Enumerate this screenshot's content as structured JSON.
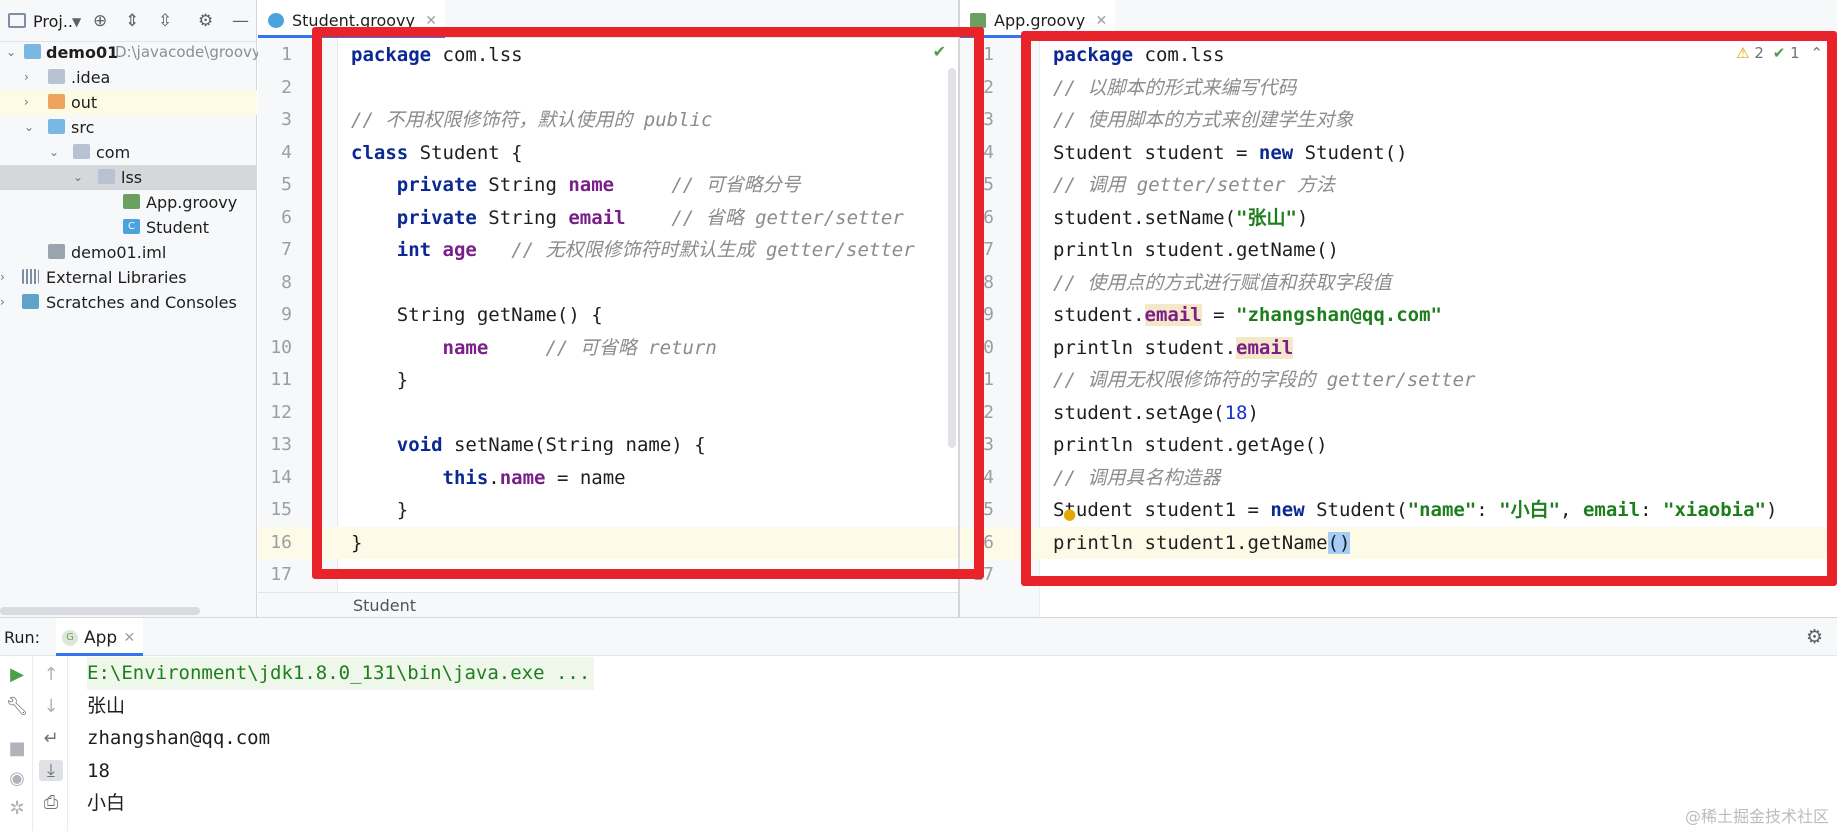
{
  "project": {
    "title": "Proj..",
    "toolbar_icons": [
      "chevron-down-icon",
      "locate-icon",
      "expand-all-icon",
      "collapse-all-icon",
      "gear-icon",
      "minimize-icon"
    ],
    "tree": [
      {
        "label": "demo01",
        "path": "D:\\javacode\\groovy",
        "icon": "module-folder-icon",
        "expanded": true
      },
      {
        "label": ".idea",
        "icon": "folder-icon",
        "expanded": false
      },
      {
        "label": "out",
        "icon": "folder-orange-icon",
        "expanded": false
      },
      {
        "label": "src",
        "icon": "source-folder-icon",
        "expanded": true
      },
      {
        "label": "com",
        "icon": "package-icon",
        "expanded": true
      },
      {
        "label": "lss",
        "icon": "package-icon",
        "expanded": true,
        "selected": true
      },
      {
        "label": "App.groovy",
        "icon": "groovy-file-icon"
      },
      {
        "label": "Student",
        "icon": "class-icon"
      },
      {
        "label": "demo01.iml",
        "icon": "iml-file-icon"
      },
      {
        "label": "External Libraries",
        "icon": "libraries-icon",
        "expanded": false
      },
      {
        "label": "Scratches and Consoles",
        "icon": "scratches-icon",
        "expanded": false
      }
    ]
  },
  "left_editor": {
    "tab": "Student.groovy",
    "status": "Student",
    "lines": [
      {
        "n": "1",
        "tokens": [
          {
            "t": "package",
            "c": "kwp"
          },
          {
            "t": " com.lss"
          }
        ]
      },
      {
        "n": "2",
        "tokens": []
      },
      {
        "n": "3",
        "tokens": [
          {
            "t": "// 不用权限修饰符，默认使用的 public",
            "c": "cmt"
          }
        ]
      },
      {
        "n": "4",
        "tokens": [
          {
            "t": "class",
            "c": "kw"
          },
          {
            "t": " Student {"
          }
        ]
      },
      {
        "n": "5",
        "tokens": [
          {
            "t": "    "
          },
          {
            "t": "private",
            "c": "kw"
          },
          {
            "t": " String "
          },
          {
            "t": "name",
            "c": "fld"
          },
          {
            "t": "     "
          },
          {
            "t": "// 可省略分号",
            "c": "cmt"
          }
        ]
      },
      {
        "n": "6",
        "tokens": [
          {
            "t": "    "
          },
          {
            "t": "private",
            "c": "kw"
          },
          {
            "t": " String "
          },
          {
            "t": "email",
            "c": "fld"
          },
          {
            "t": "    "
          },
          {
            "t": "// 省略 getter/setter",
            "c": "cmt"
          }
        ]
      },
      {
        "n": "7",
        "tokens": [
          {
            "t": "    "
          },
          {
            "t": "int",
            "c": "kw"
          },
          {
            "t": " "
          },
          {
            "t": "age",
            "c": "fld"
          },
          {
            "t": "   "
          },
          {
            "t": "// 无权限修饰符时默认生成 getter/setter",
            "c": "cmt"
          }
        ]
      },
      {
        "n": "8",
        "tokens": []
      },
      {
        "n": "9",
        "tokens": [
          {
            "t": "    String getName() {"
          }
        ]
      },
      {
        "n": "10",
        "tokens": [
          {
            "t": "        "
          },
          {
            "t": "name",
            "c": "fld"
          },
          {
            "t": "     "
          },
          {
            "t": "// 可省略 return",
            "c": "cmt"
          }
        ]
      },
      {
        "n": "11",
        "tokens": [
          {
            "t": "    }"
          }
        ]
      },
      {
        "n": "12",
        "tokens": []
      },
      {
        "n": "13",
        "tokens": [
          {
            "t": "    "
          },
          {
            "t": "void",
            "c": "kw"
          },
          {
            "t": " setName(String name) {"
          }
        ]
      },
      {
        "n": "14",
        "tokens": [
          {
            "t": "        "
          },
          {
            "t": "this",
            "c": "kw"
          },
          {
            "t": "."
          },
          {
            "t": "name",
            "c": "fld"
          },
          {
            "t": " = name"
          }
        ]
      },
      {
        "n": "15",
        "tokens": [
          {
            "t": "    }"
          }
        ]
      },
      {
        "n": "16",
        "tokens": [
          {
            "t": "}"
          }
        ],
        "current": true
      },
      {
        "n": "17",
        "tokens": []
      }
    ]
  },
  "right_editor": {
    "tab": "App.groovy",
    "warnings": "2",
    "checks": "1",
    "lines": [
      {
        "n": "1",
        "tokens": [
          {
            "t": "package",
            "c": "kwp"
          },
          {
            "t": " com.lss"
          }
        ]
      },
      {
        "n": "2",
        "tokens": [
          {
            "t": "// 以脚本的形式来编写代码",
            "c": "cmt"
          }
        ]
      },
      {
        "n": "3",
        "tokens": [
          {
            "t": "// 使用脚本的方式来创建学生对象",
            "c": "cmt"
          }
        ]
      },
      {
        "n": "4",
        "tokens": [
          {
            "t": "Student student = "
          },
          {
            "t": "new",
            "c": "kw"
          },
          {
            "t": " Student()"
          }
        ]
      },
      {
        "n": "5",
        "tokens": [
          {
            "t": "// 调用 getter/setter 方法",
            "c": "cmt"
          }
        ]
      },
      {
        "n": "6",
        "tokens": [
          {
            "t": "student.setName("
          },
          {
            "t": "\"张山\"",
            "c": "str"
          },
          {
            "t": ")"
          }
        ]
      },
      {
        "n": "7",
        "tokens": [
          {
            "t": "println student.getName()"
          }
        ]
      },
      {
        "n": "8",
        "tokens": [
          {
            "t": "// 使用点的方式进行赋值和获取字段值",
            "c": "cmt"
          }
        ]
      },
      {
        "n": "9",
        "tokens": [
          {
            "t": "student."
          },
          {
            "t": "email",
            "c": "fld hl"
          },
          {
            "t": " = "
          },
          {
            "t": "\"zhangshan@qq.com\"",
            "c": "str"
          }
        ]
      },
      {
        "n": "10",
        "tokens": [
          {
            "t": "println student."
          },
          {
            "t": "email",
            "c": "fld hl"
          }
        ]
      },
      {
        "n": "11",
        "tokens": [
          {
            "t": "// 调用无权限修饰符的字段的 getter/setter",
            "c": "cmt"
          }
        ]
      },
      {
        "n": "12",
        "tokens": [
          {
            "t": "student.setAge("
          },
          {
            "t": "18",
            "c": "num"
          },
          {
            "t": ")"
          }
        ]
      },
      {
        "n": "13",
        "tokens": [
          {
            "t": "println student.getAge()"
          }
        ]
      },
      {
        "n": "14",
        "tokens": [
          {
            "t": "// 调用具名构造器",
            "c": "cmt"
          }
        ]
      },
      {
        "n": "15",
        "tokens": [
          {
            "t": "Student student1 = "
          },
          {
            "t": "new",
            "c": "kw"
          },
          {
            "t": " Student("
          },
          {
            "t": "\"name\"",
            "c": "str"
          },
          {
            "t": ": "
          },
          {
            "t": "\"小白\"",
            "c": "str"
          },
          {
            "t": ", "
          },
          {
            "t": "email",
            "c": "named"
          },
          {
            "t": ": "
          },
          {
            "t": "\"xiaobia\"",
            "c": "str"
          },
          {
            "t": ")"
          }
        ]
      },
      {
        "n": "16",
        "tokens": [
          {
            "t": "println student1.getName"
          },
          {
            "t": "()",
            "c": "sel"
          }
        ],
        "current": true
      },
      {
        "n": "17",
        "tokens": []
      }
    ]
  },
  "run": {
    "label": "Run:",
    "tab": "App",
    "output": [
      {
        "text": "E:\\Environment\\jdk1.8.0_131\\bin\\java.exe ...",
        "kind": "cmd"
      },
      {
        "text": "张山",
        "kind": "cjk"
      },
      {
        "text": "zhangshan@qq.com",
        "kind": "plain"
      },
      {
        "text": "18",
        "kind": "plain"
      },
      {
        "text": "小白",
        "kind": "cjk"
      }
    ]
  },
  "watermark": "@稀土掘金技术社区"
}
